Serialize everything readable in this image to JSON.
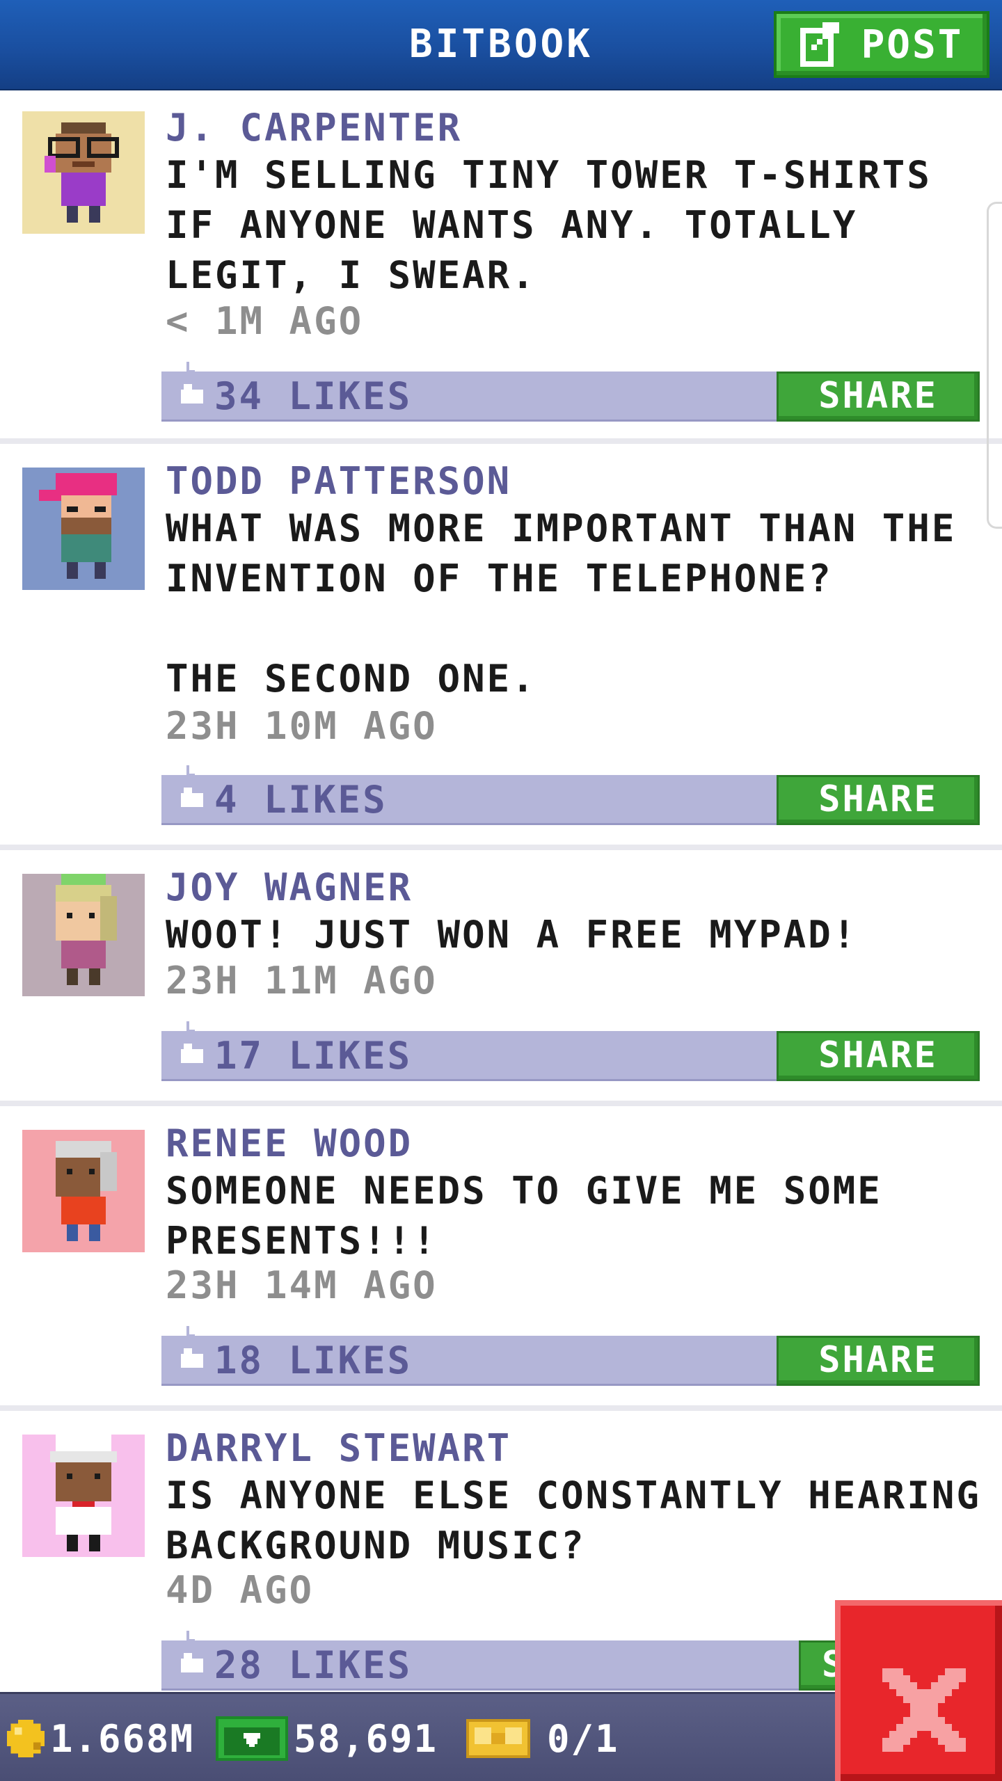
{
  "header": {
    "title": "BITBOOK",
    "post_label": "POST"
  },
  "posts": [
    {
      "author": "J. CARPENTER",
      "message": "I'M SELLING TINY TOWER T-SHIRTS IF ANYONE WANTS ANY. TOTALLY LEGIT, I SWEAR.",
      "time": "< 1M AGO",
      "likes": "34 LIKES",
      "share_label": "SHARE",
      "avatar_bg": "#efe0a8"
    },
    {
      "author": "TODD PATTERSON",
      "message": "WHAT WAS MORE IMPORTANT THAN THE INVENTION OF THE TELEPHONE?\n\nTHE SECOND ONE.",
      "time": "23H 10M AGO",
      "likes": "4 LIKES",
      "share_label": "SHARE",
      "avatar_bg": "#7f96c8"
    },
    {
      "author": "JOY WAGNER",
      "message": "WOOT! JUST WON A FREE MYPAD!",
      "time": "23H 11M AGO",
      "likes": "17 LIKES",
      "share_label": "SHARE",
      "avatar_bg": "#bbaab4"
    },
    {
      "author": "RENEE WOOD",
      "message": "SOMEONE NEEDS TO GIVE ME SOME PRESENTS!!!",
      "time": "23H 14M AGO",
      "likes": "18 LIKES",
      "share_label": "SHARE",
      "avatar_bg": "#f4a3aa"
    },
    {
      "author": "DARRYL STEWART",
      "message": "IS ANYONE ELSE CONSTANTLY HEARING BACKGROUND MUSIC?",
      "time": "4D AGO",
      "likes": "28 LIKES",
      "share_label": "S",
      "avatar_bg": "#f8c0ec"
    }
  ],
  "footer": {
    "coins": "1.668M",
    "bux": "58,691",
    "tickets": "0/1"
  },
  "colors": {
    "header_blue": "#1a4fa0",
    "accent_green": "#3fa63a",
    "author_purple": "#5b5a96",
    "like_bar": "#b4b5d9",
    "close_red": "#e8262b"
  }
}
